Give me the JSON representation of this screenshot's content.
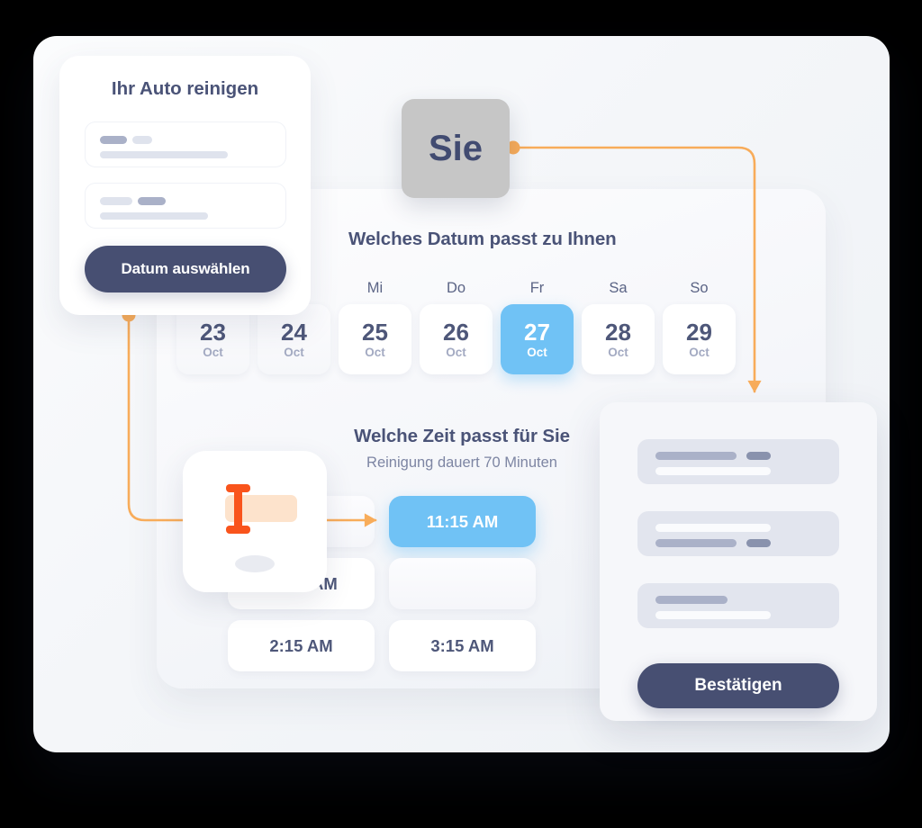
{
  "form_card": {
    "title": "Ihr Auto reinigen",
    "submit_label": "Datum auswählen",
    "fields": [
      {
        "name": "service-field",
        "placeholder": ""
      },
      {
        "name": "vehicle-field",
        "placeholder": ""
      }
    ]
  },
  "badge": {
    "label": "Sie"
  },
  "booking": {
    "date_heading": "Welches Datum passt zu Ihnen",
    "time_heading": "Welche Zeit passt für Sie",
    "time_subheading": "Reinigung dauert 70 Minuten",
    "month": "Oct",
    "days": [
      {
        "weekday": "",
        "number": "23",
        "month": "Oct",
        "selected": false
      },
      {
        "weekday": "",
        "number": "24",
        "month": "Oct",
        "selected": false
      },
      {
        "weekday": "Mi",
        "number": "25",
        "month": "Oct",
        "selected": false
      },
      {
        "weekday": "Do",
        "number": "26",
        "month": "Oct",
        "selected": false
      },
      {
        "weekday": "Fr",
        "number": "27",
        "month": "Oct",
        "selected": true
      },
      {
        "weekday": "Sa",
        "number": "28",
        "month": "Oct",
        "selected": false
      },
      {
        "weekday": "So",
        "number": "29",
        "month": "Oct",
        "selected": false
      }
    ],
    "times": [
      {
        "label": "11:15 AM",
        "selected": true
      },
      {
        "label": "12:15 AM",
        "selected": false
      },
      {
        "label": "2:15 AM",
        "selected": false
      },
      {
        "label": "3:15 AM",
        "selected": false
      }
    ]
  },
  "summary_card": {
    "confirm_label": "Bestätigen",
    "rows": [
      "summary-row-1",
      "summary-row-2",
      "summary-row-3"
    ]
  },
  "cursor_card": {
    "icon": "text-cursor-icon"
  },
  "colors": {
    "accent_blue": "#70c2f5",
    "dark_navy": "#474f72",
    "connector_orange": "#f8ac5a",
    "cursor_orange": "#f9541c",
    "badge_grey": "#c6c6c6",
    "text_navy": "#4a5377",
    "muted_text": "#7d85a3"
  }
}
